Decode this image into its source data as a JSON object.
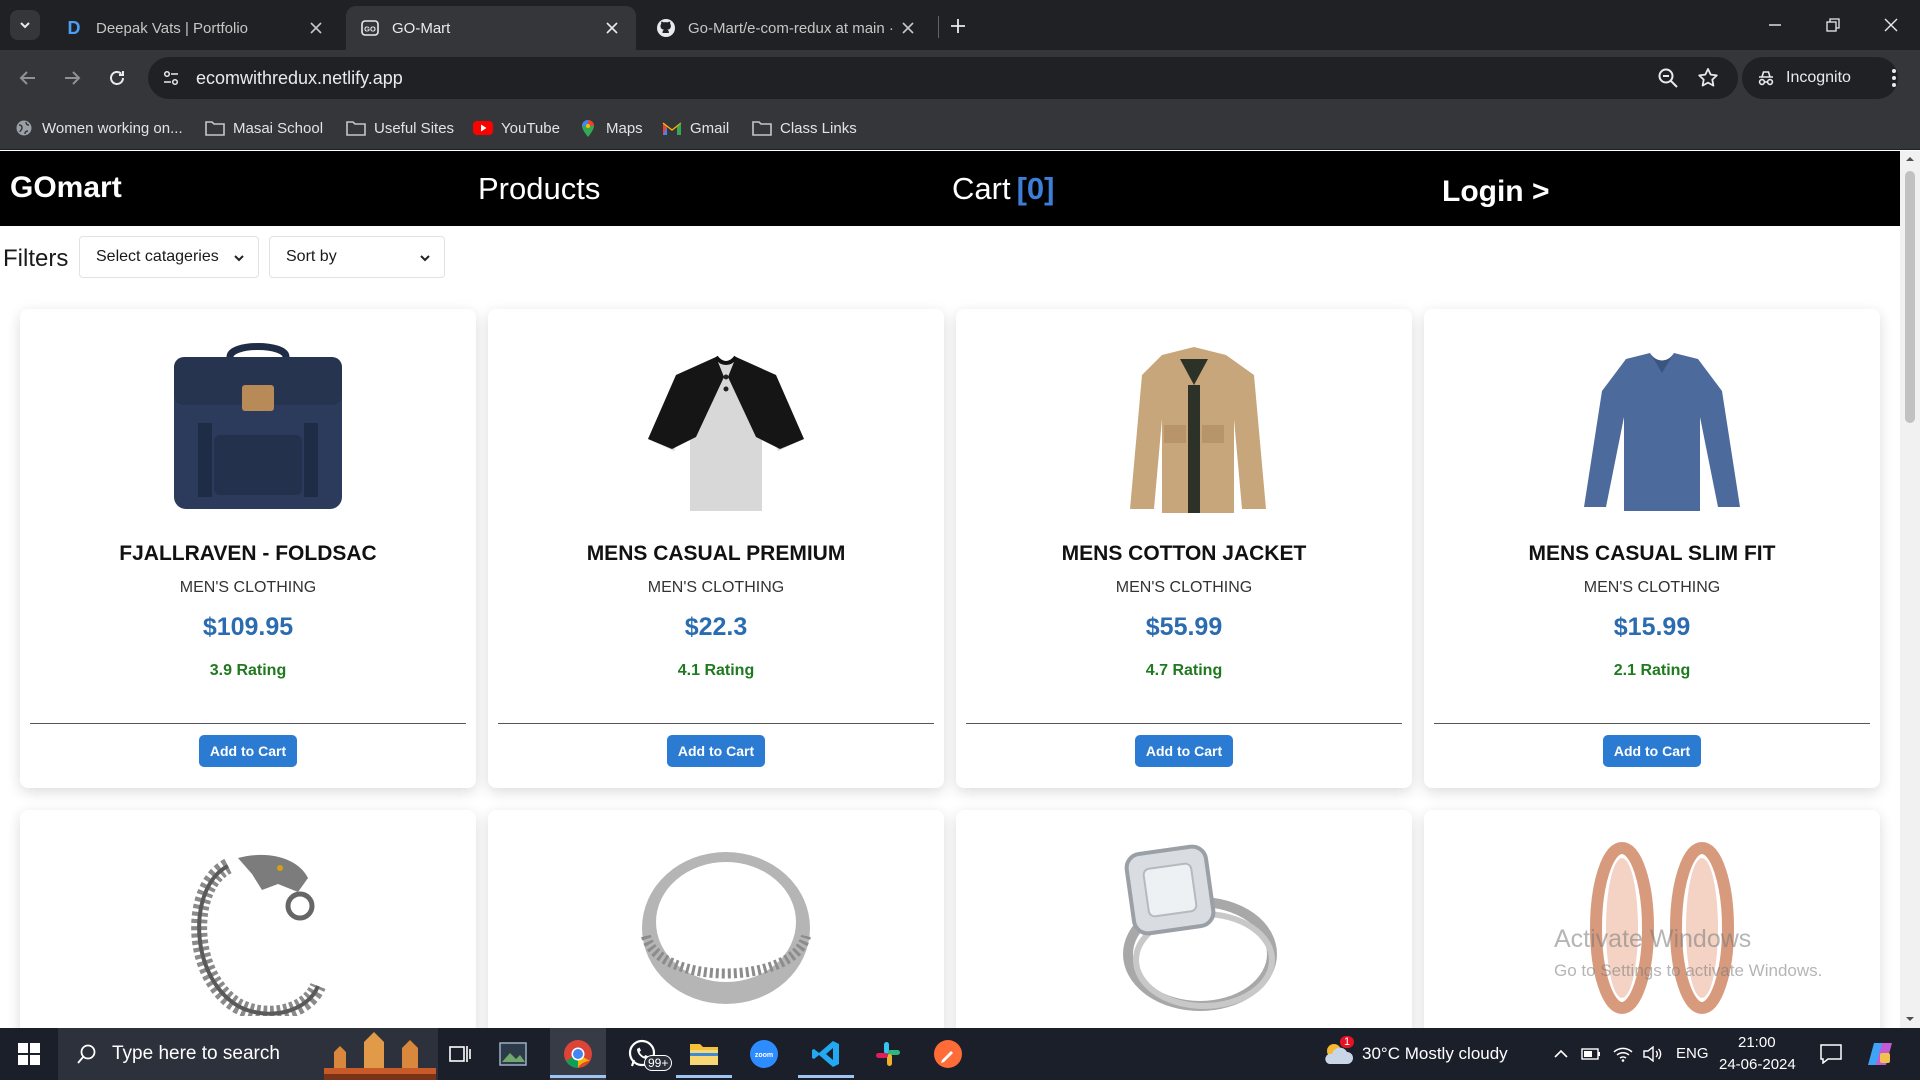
{
  "browser": {
    "tabs": [
      {
        "title": "Deepak Vats | Portfolio",
        "favicon_letter": "D",
        "active": false
      },
      {
        "title": "GO-Mart",
        "active": true
      },
      {
        "title": "Go-Mart/e-com-redux at main ·",
        "active": false
      }
    ],
    "new_tab_glyph": "+",
    "url": "ecomwithredux.netlify.app",
    "incognito_label": "Incognito",
    "bookmarks": [
      {
        "label": "Women working on...",
        "icon": "globe-icon"
      },
      {
        "label": "Masai School",
        "icon": "folder-icon"
      },
      {
        "label": "Useful Sites",
        "icon": "folder-icon"
      },
      {
        "label": "YouTube",
        "icon": "youtube-icon"
      },
      {
        "label": "Maps",
        "icon": "maps-icon"
      },
      {
        "label": "Gmail",
        "icon": "gmail-icon"
      },
      {
        "label": "Class Links",
        "icon": "folder-icon"
      }
    ]
  },
  "site": {
    "brand": "GOmart",
    "nav": {
      "products": "Products",
      "cart_label": "Cart",
      "cart_count": "[0]",
      "login": "Login >"
    },
    "filters": {
      "label": "Filters",
      "category_select": "Select catageries",
      "sort_select": "Sort by"
    },
    "products": [
      {
        "name": "FJALLRAVEN - FOLDSAC",
        "category": "MEN'S CLOTHING",
        "price": "$109.95",
        "rating": "3.9 Rating",
        "button": "Add to Cart",
        "image": "backpack"
      },
      {
        "name": "MENS CASUAL PREMIUM",
        "category": "MEN'S CLOTHING",
        "price": "$22.3",
        "rating": "4.1 Rating",
        "button": "Add to Cart",
        "image": "raglan-tshirt"
      },
      {
        "name": "MENS COTTON JACKET",
        "category": "MEN'S CLOTHING",
        "price": "$55.99",
        "rating": "4.7 Rating",
        "button": "Add to Cart",
        "image": "jacket"
      },
      {
        "name": "MENS CASUAL SLIM FIT",
        "category": "MEN'S CLOTHING",
        "price": "$15.99",
        "rating": "2.1 Rating",
        "button": "Add to Cart",
        "image": "longsleeve-shirt"
      },
      {
        "image": "dragon-bracelet"
      },
      {
        "image": "silver-ring"
      },
      {
        "image": "diamond-ring"
      },
      {
        "image": "rose-gold-earrings"
      }
    ],
    "colors": {
      "nav_bg": "#000000",
      "accent_blue": "#2b6cb0",
      "button_blue": "#2b7bd3",
      "rating_green": "#1f7a1f"
    }
  },
  "watermark": {
    "line1": "Activate Windows",
    "line2": "Go to Settings to activate Windows."
  },
  "taskbar": {
    "search_placeholder": "Type here to search",
    "whatsapp_badge": "99+",
    "weather": "30°C  Mostly cloudy",
    "weather_badge": "1",
    "language": "ENG",
    "time": "21:00",
    "date": "24-06-2024"
  }
}
